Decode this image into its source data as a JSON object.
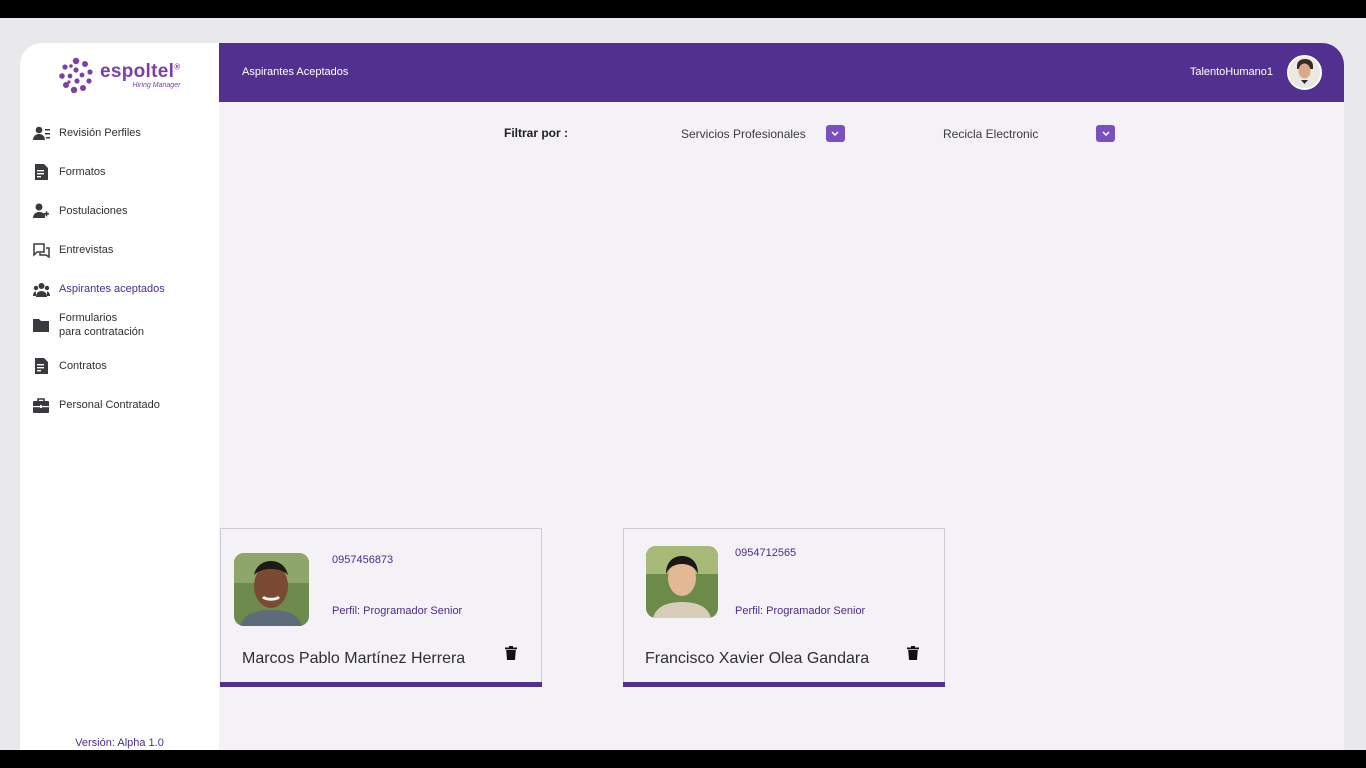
{
  "brand": {
    "name": "espoltel",
    "tagline": "Hiring Manager",
    "registered_mark": "®",
    "color": "#7b3fa6"
  },
  "header": {
    "title": "Aspirantes Aceptados",
    "username": "TalentoHumano1",
    "color": "#523090"
  },
  "sidebar": {
    "items": [
      {
        "label": "Revisión Perfiles",
        "icon": "user-list-icon",
        "active": false
      },
      {
        "label": "Formatos",
        "icon": "document-icon",
        "active": false
      },
      {
        "label": "Postulaciones",
        "icon": "add-user-icon",
        "active": false
      },
      {
        "label": "Entrevistas",
        "icon": "chat-icon",
        "active": false
      },
      {
        "label": "Aspirantes aceptados",
        "icon": "group-icon",
        "active": true
      },
      {
        "label_line1": "Formularios",
        "label_line2": "para contratación",
        "icon": "folder-icon",
        "active": false
      },
      {
        "label": "Contratos",
        "icon": "document-icon",
        "active": false
      },
      {
        "label": "Personal Contratado",
        "icon": "briefcase-icon",
        "active": false
      }
    ],
    "version": "Versión: Alpha 1.0"
  },
  "filter": {
    "label": "Filtrar por :",
    "service_select": {
      "value": "Servicios Profesionales"
    },
    "company_select": {
      "value": "Recicla Electronic"
    }
  },
  "candidates": [
    {
      "id": "0957456873",
      "profile": "Perfil: Programador Senior",
      "name": "Marcos Pablo Martínez Herrera"
    },
    {
      "id": "0954712565",
      "profile": "Perfil: Programador Senior",
      "name": "Francisco Xavier Olea Gandara"
    }
  ]
}
